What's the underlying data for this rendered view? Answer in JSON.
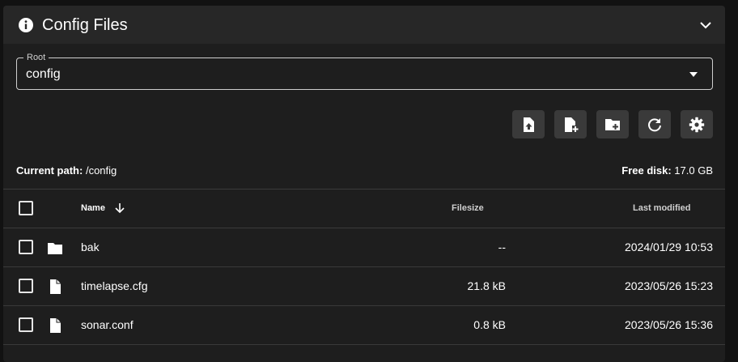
{
  "header": {
    "title": "Config Files",
    "icon": "info-icon",
    "collapse_icon": "chevron-up-icon"
  },
  "root_select": {
    "label": "Root",
    "value": "config"
  },
  "toolbar": {
    "buttons": [
      {
        "name": "upload-file-button",
        "icon": "file-upload-icon"
      },
      {
        "name": "create-file-button",
        "icon": "file-plus-icon"
      },
      {
        "name": "create-folder-button",
        "icon": "folder-plus-icon"
      },
      {
        "name": "refresh-button",
        "icon": "refresh-icon"
      },
      {
        "name": "settings-button",
        "icon": "gear-icon"
      }
    ]
  },
  "status": {
    "path_label": "Current path:",
    "path_value": "/config",
    "disk_label": "Free disk:",
    "disk_value": "17.0 GB"
  },
  "table": {
    "columns": {
      "name": "Name",
      "filesize": "Filesize",
      "modified": "Last modified"
    },
    "rows": [
      {
        "type": "folder",
        "icon": "folder-icon",
        "name": "bak",
        "size": "--",
        "modified": "2024/01/29 10:53"
      },
      {
        "type": "file",
        "icon": "file-icon",
        "name": "timelapse.cfg",
        "size": "21.8 kB",
        "modified": "2023/05/26 15:23"
      },
      {
        "type": "file",
        "icon": "file-icon",
        "name": "sonar.conf",
        "size": "0.8 kB",
        "modified": "2023/05/26 15:36"
      }
    ]
  },
  "colors": {
    "page_bg": "#121212",
    "card_bg": "#1e1e1e",
    "header_bg": "#272727",
    "button_bg": "#3a3a3a",
    "divider": "#3a3a3a",
    "text": "#ffffff"
  }
}
